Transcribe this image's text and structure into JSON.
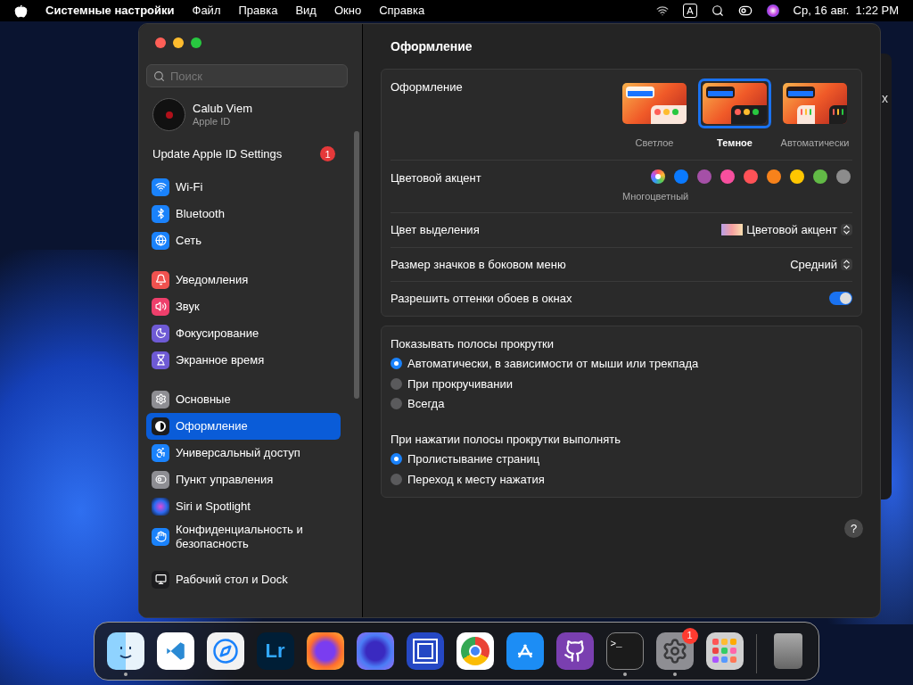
{
  "menubar": {
    "app": "Системные настройки",
    "menus": [
      "Файл",
      "Правка",
      "Вид",
      "Окно",
      "Справка"
    ],
    "input_source": "A",
    "clock": "Ср, 16 авг.  1:22 PM"
  },
  "background_window": {
    "close_glyph": "x"
  },
  "sidebar": {
    "search": {
      "placeholder": "Поиск"
    },
    "account": {
      "name": "Calub Viem",
      "subtitle": "Apple ID"
    },
    "update": {
      "label": "Update Apple ID Settings",
      "badge": "1"
    },
    "groups": [
      [
        {
          "label": "Wi-Fi",
          "selected": false
        },
        {
          "label": "Bluetooth",
          "selected": false
        },
        {
          "label": "Сеть",
          "selected": false
        }
      ],
      [
        {
          "label": "Уведомления",
          "selected": false
        },
        {
          "label": "Звук",
          "selected": false
        },
        {
          "label": "Фокусирование",
          "selected": false
        },
        {
          "label": "Экранное время",
          "selected": false
        }
      ],
      [
        {
          "label": "Основные",
          "selected": false
        },
        {
          "label": "Оформление",
          "selected": true
        },
        {
          "label": "Универсальный доступ",
          "selected": false
        },
        {
          "label": "Пункт управления",
          "selected": false
        },
        {
          "label": "Siri и Spotlight",
          "selected": false
        },
        {
          "label": "Конфиденциальность и безопасность",
          "selected": false
        }
      ],
      [
        {
          "label": "Рабочий стол и Dock",
          "selected": false
        }
      ]
    ]
  },
  "content": {
    "title": "Оформление",
    "appearance": {
      "label": "Оформление",
      "options": [
        {
          "label": "Светлое",
          "kind": "light",
          "selected": false
        },
        {
          "label": "Темное",
          "kind": "dark",
          "selected": true
        },
        {
          "label": "Автоматически",
          "kind": "auto",
          "selected": false
        }
      ]
    },
    "accent": {
      "label": "Цветовой акцент",
      "caption": "Многоцветный",
      "colors": [
        {
          "kind": "multicolor",
          "selected": true
        },
        {
          "kind": "solid",
          "color": "#0a7aff",
          "selected": false
        },
        {
          "kind": "solid",
          "color": "#a550a7",
          "selected": false
        },
        {
          "kind": "solid",
          "color": "#f74f9e",
          "selected": false
        },
        {
          "kind": "solid",
          "color": "#ff5257",
          "selected": false
        },
        {
          "kind": "solid",
          "color": "#f7821b",
          "selected": false
        },
        {
          "kind": "solid",
          "color": "#ffc600",
          "selected": false
        },
        {
          "kind": "solid",
          "color": "#62ba46",
          "selected": false
        },
        {
          "kind": "solid",
          "color": "#8c8c8c",
          "selected": false
        }
      ]
    },
    "highlight": {
      "label": "Цвет выделения",
      "value": "Цветовой акцент"
    },
    "icon_size": {
      "label": "Размер значков в боковом меню",
      "value": "Средний"
    },
    "tinting": {
      "label": "Разрешить оттенки обоев в окнах",
      "on": true
    },
    "scrollbars": {
      "label": "Показывать полосы прокрутки",
      "options": [
        {
          "label": "Автоматически, в зависимости от мыши или трекпада",
          "selected": true
        },
        {
          "label": "При прокручивании",
          "selected": false
        },
        {
          "label": "Всегда",
          "selected": false
        }
      ]
    },
    "click": {
      "label": "При нажатии полосы прокрутки выполнять",
      "options": [
        {
          "label": "Пролистывание страниц",
          "selected": true
        },
        {
          "label": "Переход к месту нажатия",
          "selected": false
        }
      ]
    },
    "help": "?"
  },
  "dock": {
    "items": [
      {
        "kind": "finder",
        "running": true
      },
      {
        "kind": "vscode",
        "running": false
      },
      {
        "kind": "safari",
        "running": false
      },
      {
        "kind": "lightroom",
        "text": "Lr",
        "running": false
      },
      {
        "kind": "firefox",
        "running": false
      },
      {
        "kind": "firefox-dev",
        "running": false
      },
      {
        "kind": "squares",
        "running": false
      },
      {
        "kind": "chrome",
        "running": false
      },
      {
        "kind": "appstore",
        "running": false
      },
      {
        "kind": "github",
        "running": false
      },
      {
        "kind": "terminal",
        "text": ">_",
        "running": true
      },
      {
        "kind": "settings",
        "badge": "1",
        "running": true
      },
      {
        "kind": "launchpad",
        "running": false
      },
      {
        "kind": "trash",
        "running": false
      }
    ]
  }
}
